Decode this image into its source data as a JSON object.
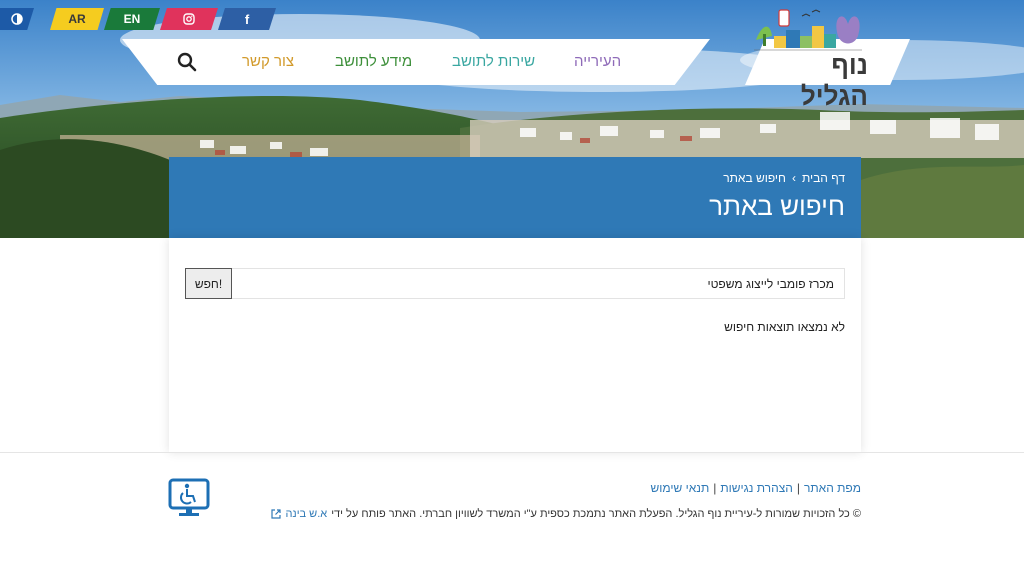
{
  "topbar": {
    "contrast_icon": "contrast-icon",
    "ar_label": "AR",
    "en_label": "EN",
    "instagram_icon": "instagram-icon",
    "facebook_label": "f"
  },
  "nav": {
    "items": [
      {
        "label": "העירייה",
        "color": "#8e6ab8"
      },
      {
        "label": "שירות לתושב",
        "color": "#3aa7a1"
      },
      {
        "label": "מידע לתושב",
        "color": "#3d8f3a"
      },
      {
        "label": "צור קשר",
        "color": "#d29a2b"
      }
    ],
    "search_icon": "search-icon"
  },
  "logo": {
    "text": "נוף הגליל"
  },
  "header": {
    "breadcrumb": {
      "home": "דף הבית",
      "current": "חיפוש באתר"
    },
    "title": "חיפוש באתר"
  },
  "search": {
    "value": "מכרז פומבי לייצוג משפטי",
    "button_label": "חפש!"
  },
  "results": {
    "empty_message": "לא נמצאו תוצאות חיפוש"
  },
  "footer": {
    "links": [
      "מפת האתר",
      "הצהרת נגישות",
      "תנאי שימוש"
    ],
    "separator": "|",
    "copyright": "© כל הזכויות שמורות ל-עיריית נוף הגליל. הפעלת האתר נתמכת כספית ע\"י המשרד לשוויון חברתי. האתר פותח על ידי",
    "developer": "א.ש בינה",
    "accessibility_icon": "accessibility-icon"
  },
  "colors": {
    "brand_blue": "#2f79b6",
    "link_blue": "#2f79b6"
  }
}
